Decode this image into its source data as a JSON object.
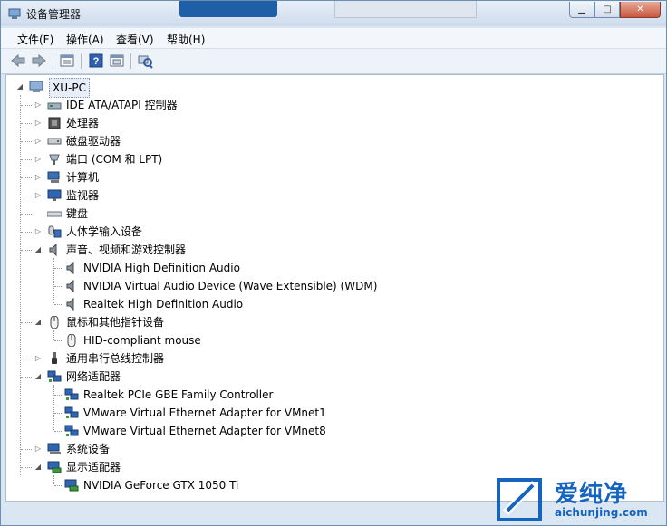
{
  "window": {
    "title": "设备管理器",
    "accent": "#1f5fa8"
  },
  "menu": [
    "文件(F)",
    "操作(A)",
    "查看(V)",
    "帮助(H)"
  ],
  "toolbar": [
    "back-icon",
    "forward-icon",
    "properties-view-icon",
    "help-icon",
    "show-hidden-icon",
    "scan-hardware-icon"
  ],
  "tree": {
    "root": "XU-PC",
    "categories": [
      {
        "label": "IDE ATA/ATAPI 控制器",
        "icon": "ide-controller-icon",
        "expanded": false,
        "children": []
      },
      {
        "label": "处理器",
        "icon": "processor-icon",
        "expanded": false,
        "children": []
      },
      {
        "label": "磁盘驱动器",
        "icon": "disk-drive-icon",
        "expanded": false,
        "children": []
      },
      {
        "label": "端口 (COM 和 LPT)",
        "icon": "port-icon",
        "expanded": false,
        "children": []
      },
      {
        "label": "计算机",
        "icon": "computer-icon",
        "expanded": false,
        "children": []
      },
      {
        "label": "监视器",
        "icon": "monitor-icon",
        "expanded": false,
        "children": []
      },
      {
        "label": "键盘",
        "icon": "keyboard-icon",
        "expanded": false,
        "children": []
      },
      {
        "label": "人体学输入设备",
        "icon": "hid-icon",
        "expanded": false,
        "children": []
      },
      {
        "label": "声音、视频和游戏控制器",
        "icon": "sound-icon",
        "expanded": true,
        "children": [
          "NVIDIA High Definition Audio",
          "NVIDIA Virtual Audio Device (Wave Extensible) (WDM)",
          "Realtek High Definition Audio"
        ]
      },
      {
        "label": "鼠标和其他指针设备",
        "icon": "mouse-icon",
        "expanded": true,
        "children": [
          "HID-compliant mouse"
        ]
      },
      {
        "label": "通用串行总线控制器",
        "icon": "usb-icon",
        "expanded": false,
        "children": []
      },
      {
        "label": "网络适配器",
        "icon": "network-icon",
        "expanded": true,
        "children": [
          "Realtek PCIe GBE Family Controller",
          "VMware Virtual Ethernet Adapter for VMnet1",
          "VMware Virtual Ethernet Adapter for VMnet8"
        ]
      },
      {
        "label": "系统设备",
        "icon": "system-device-icon",
        "expanded": false,
        "children": []
      },
      {
        "label": "显示适配器",
        "icon": "display-adapter-icon",
        "expanded": true,
        "children": [
          "NVIDIA GeForce GTX 1050 Ti"
        ]
      }
    ]
  },
  "watermark": {
    "brand": "爱纯净",
    "url": "aichunjing.com",
    "color": "#1565c0"
  }
}
